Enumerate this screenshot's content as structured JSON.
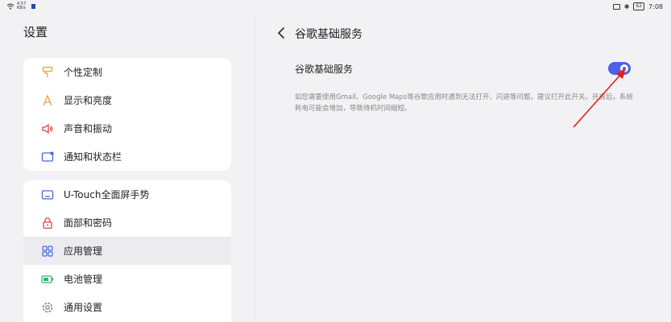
{
  "status_bar": {
    "net_speed": "4.57",
    "net_unit": "KB/s",
    "battery": "62",
    "time": "7:08"
  },
  "left": {
    "title": "设置",
    "group1": [
      {
        "label": "个性定制",
        "icon": "brush-icon"
      },
      {
        "label": "显示和亮度",
        "icon": "font-a-icon"
      },
      {
        "label": "声音和振动",
        "icon": "speaker-icon"
      },
      {
        "label": "通知和状态栏",
        "icon": "notification-icon"
      }
    ],
    "group2": [
      {
        "label": "U-Touch全面屏手势",
        "icon": "gesture-icon"
      },
      {
        "label": "面部和密码",
        "icon": "lock-icon"
      },
      {
        "label": "应用管理",
        "icon": "apps-grid-icon",
        "selected": true
      },
      {
        "label": "电池管理",
        "icon": "battery-icon"
      },
      {
        "label": "通用设置",
        "icon": "gear-icon"
      }
    ]
  },
  "right": {
    "title": "谷歌基础服务",
    "toggle_label": "谷歌基础服务",
    "toggle_on": true,
    "description": "如您需要使用Gmail、Google Maps等谷歌应用时遇到无法打开、闪退等问题，建议打开此开关。开启后，系统耗电可能会增加，导致待机时间缩短。"
  },
  "colors": {
    "accent": "#4a63e8",
    "annotation_arrow": "#e02020"
  }
}
